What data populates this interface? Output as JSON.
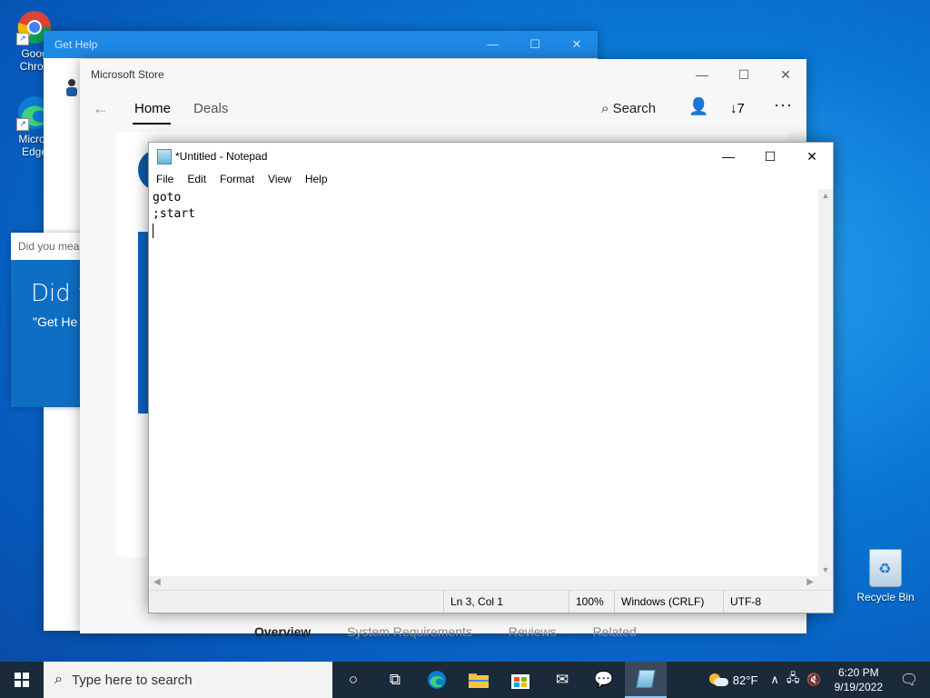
{
  "desktop": {
    "icons": [
      {
        "label": "Google Chrome",
        "visible_label": "Goog Chron"
      },
      {
        "label": "Microsoft Edge",
        "visible_label": "Micros Edge"
      }
    ],
    "recycle_bin": "Recycle Bin"
  },
  "get_help": {
    "title": "Get Help",
    "did_you_mean_header": "Did you mea",
    "did_you_big": "Did y",
    "did_you_small": "\"Get He"
  },
  "store": {
    "title": "Microsoft Store",
    "tabs": {
      "home": "Home",
      "deals": "Deals"
    },
    "search_label": "Search",
    "downloads_count": "7",
    "bottom_tabs": [
      "Overview",
      "System Requirements",
      "Reviews",
      "Related"
    ]
  },
  "notepad": {
    "title": "*Untitled - Notepad",
    "menu": [
      "File",
      "Edit",
      "Format",
      "View",
      "Help"
    ],
    "content_lines": [
      "goto",
      ";start",
      ""
    ],
    "status": {
      "position": "Ln 3, Col 1",
      "zoom": "100%",
      "line_ending": "Windows (CRLF)",
      "encoding": "UTF-8"
    }
  },
  "taskbar": {
    "search_placeholder": "Type here to search",
    "weather": "82°F",
    "time": "6:20 PM",
    "date": "9/19/2022"
  }
}
